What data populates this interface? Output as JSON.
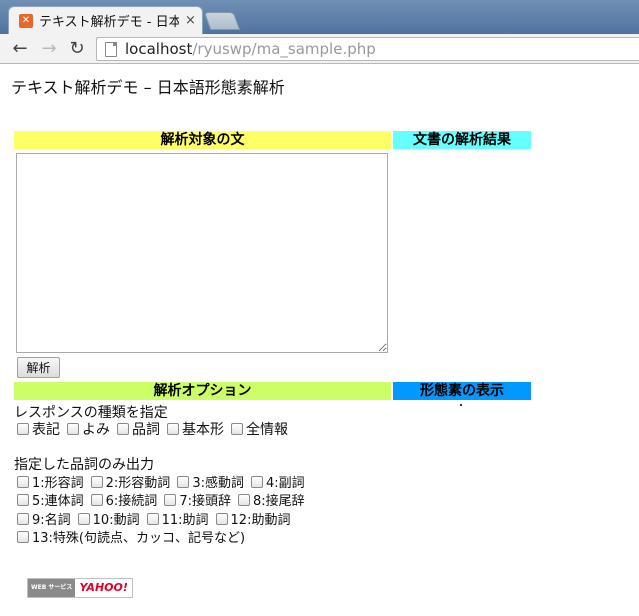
{
  "browser": {
    "tab_title": "テキスト解析デモ - 日本語",
    "tab_close": "×",
    "favicon_glyph": "✕",
    "back_glyph": "←",
    "forward_glyph": "→",
    "reload_glyph": "↻",
    "url_host": "localhost",
    "url_path": "/ryuswp/ma_sample.php"
  },
  "page": {
    "title": "テキスト解析デモ – 日本語形態素解析",
    "headers": {
      "input": "解析対象の文",
      "result": "文書の解析結果",
      "options": "解析オプション",
      "display": "形態素の表示"
    },
    "analyze_button": "解析",
    "response_label": "レスポンスの種類を指定",
    "response_types": [
      "表記",
      "よみ",
      "品詞",
      "基本形",
      "全情報"
    ],
    "pos_label": "指定した品詞のみ出力",
    "pos_rows": [
      [
        "1:形容詞",
        "2:形容動詞",
        "3:感動詞",
        "4:副詞"
      ],
      [
        "5:連体詞",
        "6:接続詞",
        "7:接頭辞",
        "8:接尾辞"
      ],
      [
        "9:名詞",
        "10:動詞",
        "11:助詞",
        "12:助動詞"
      ],
      [
        "13:特殊(句読点、カッコ、記号など)"
      ]
    ],
    "credit_left": "WEB サービス",
    "credit_right": "YAHOO!"
  },
  "colors": {
    "input_header": "#ffff66",
    "result_header": "#66ffff",
    "options_header": "#ccff66",
    "display_header": "#0099ff"
  }
}
